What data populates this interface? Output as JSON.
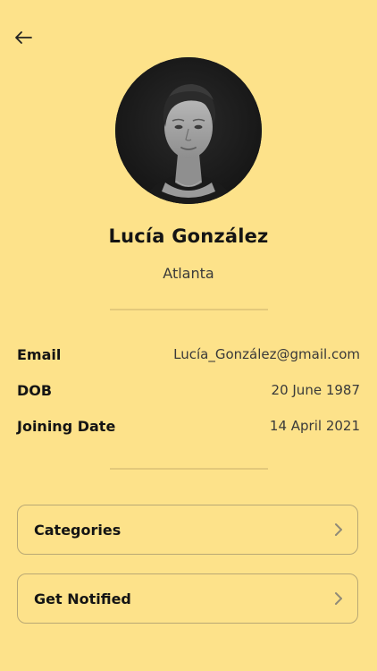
{
  "header": {
    "back_icon": "arrow-left-icon"
  },
  "profile": {
    "name": "Lucía González",
    "city": "Atlanta",
    "avatar": "profile-photo"
  },
  "details": [
    {
      "label": "Email",
      "value": "Lucía_González@gmail.com"
    },
    {
      "label": "DOB",
      "value": "20 June 1987"
    },
    {
      "label": "Joining Date",
      "value": "14 April 2021"
    }
  ],
  "menu": [
    {
      "label": "Categories",
      "icon": "chevron-right-icon"
    },
    {
      "label": "Get Notified",
      "icon": "chevron-right-icon"
    }
  ],
  "colors": {
    "background": "#fde28a",
    "text": "#141414",
    "muted_text": "#3a3a3a",
    "border": "#b9a874",
    "divider": "#e3c97b"
  }
}
